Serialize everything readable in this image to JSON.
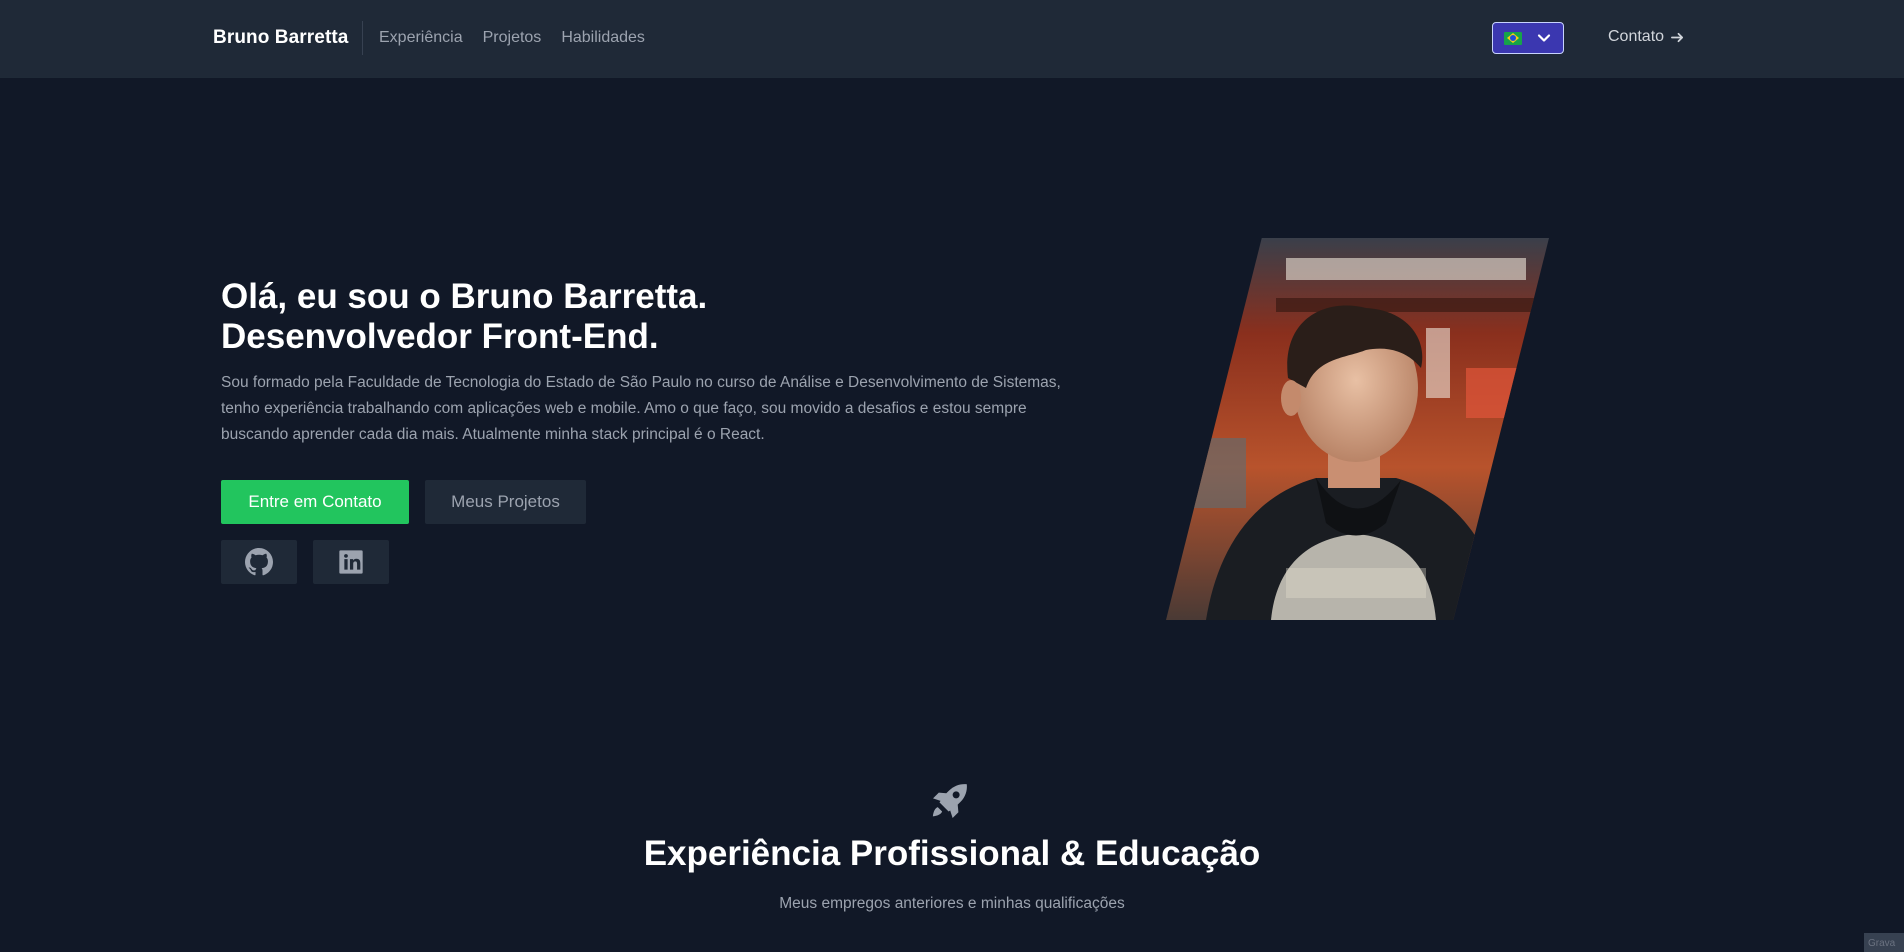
{
  "header": {
    "brand": "Bruno Barretta",
    "nav": [
      "Experiência",
      "Projetos",
      "Habilidades"
    ],
    "language_flag": "brazil-flag",
    "contact_label": "Contato"
  },
  "hero": {
    "title_line1": "Olá, eu sou o Bruno Barretta.",
    "title_line2": "Desenvolvedor Front-End.",
    "description": "Sou formado pela Faculdade de Tecnologia do Estado de São Paulo no curso de Análise e Desenvolvimento de Sistemas, tenho experiência trabalhando com aplicações web e mobile. Amo o que faço, sou movido a desafios e estou sempre buscando aprender cada dia mais. Atualmente minha stack principal é o React.",
    "primary_button": "Entre em Contato",
    "secondary_button": "Meus Projetos",
    "social_icons": [
      "github-icon",
      "linkedin-icon"
    ]
  },
  "experience": {
    "icon": "rocket-icon",
    "title": "Experiência Profissional & Educação",
    "subtitle": "Meus empregos anteriores e minhas qualificações"
  },
  "corner_badge": "Grava",
  "colors": {
    "background": "#111827",
    "header": "#1f2937",
    "accent_green": "#22c55e",
    "language_select": "#3b37b0"
  }
}
